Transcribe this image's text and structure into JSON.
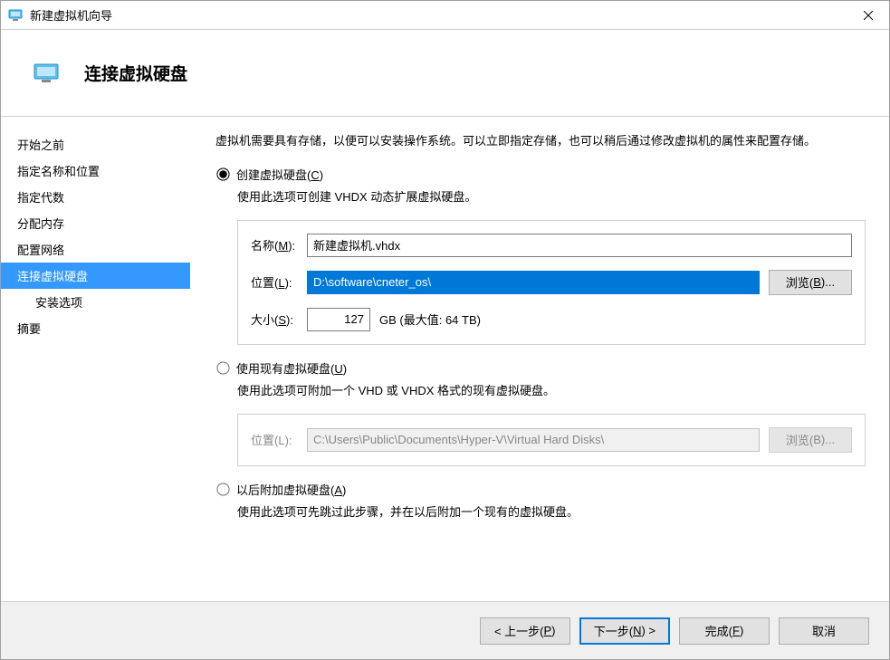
{
  "window_title": "新建虚拟机向导",
  "page_title": "连接虚拟硬盘",
  "sidebar": {
    "items": [
      {
        "label": "开始之前"
      },
      {
        "label": "指定名称和位置"
      },
      {
        "label": "指定代数"
      },
      {
        "label": "分配内存"
      },
      {
        "label": "配置网络"
      },
      {
        "label": "连接虚拟硬盘",
        "selected": true
      },
      {
        "label": "安装选项",
        "sub": true
      },
      {
        "label": "摘要"
      }
    ]
  },
  "content": {
    "intro": "虚拟机需要具有存储，以便可以安装操作系统。可以立即指定存储，也可以稍后通过修改虚拟机的属性来配置存储。",
    "option_create": {
      "label_pre": "创建虚拟硬盘(",
      "hotkey": "C",
      "label_post": ")",
      "desc": "使用此选项可创建 VHDX 动态扩展虚拟硬盘。",
      "name_label_pre": "名称(",
      "name_hotkey": "M",
      "name_label_post": "):",
      "name_value": "新建虚拟机.vhdx",
      "loc_label_pre": "位置(",
      "loc_hotkey": "L",
      "loc_label_post": "):",
      "loc_value": "D:\\software\\cneter_os\\",
      "browse_label_pre": "浏览(",
      "browse_hotkey": "B",
      "browse_label_post": ")...",
      "size_label_pre": "大小(",
      "size_hotkey": "S",
      "size_label_post": "):",
      "size_value": "127",
      "size_unit": "GB (最大值: 64 TB)"
    },
    "option_existing": {
      "label_pre": "使用现有虚拟硬盘(",
      "hotkey": "U",
      "label_post": ")",
      "desc": "使用此选项可附加一个 VHD 或 VHDX 格式的现有虚拟硬盘。",
      "loc_label_pre": "位置(",
      "loc_hotkey": "L",
      "loc_label_post": "):",
      "loc_value": "C:\\Users\\Public\\Documents\\Hyper-V\\Virtual Hard Disks\\",
      "browse_label_pre": "浏览(",
      "browse_hotkey": "B",
      "browse_label_post": ")..."
    },
    "option_later": {
      "label_pre": "以后附加虚拟硬盘(",
      "hotkey": "A",
      "label_post": ")",
      "desc": "使用此选项可先跳过此步骤，并在以后附加一个现有的虚拟硬盘。"
    }
  },
  "footer": {
    "prev_pre": "< 上一步(",
    "prev_hotkey": "P",
    "prev_post": ")",
    "next_pre": "下一步(",
    "next_hotkey": "N",
    "next_post": ") >",
    "finish_pre": "完成(",
    "finish_hotkey": "F",
    "finish_post": ")",
    "cancel": "取消"
  }
}
